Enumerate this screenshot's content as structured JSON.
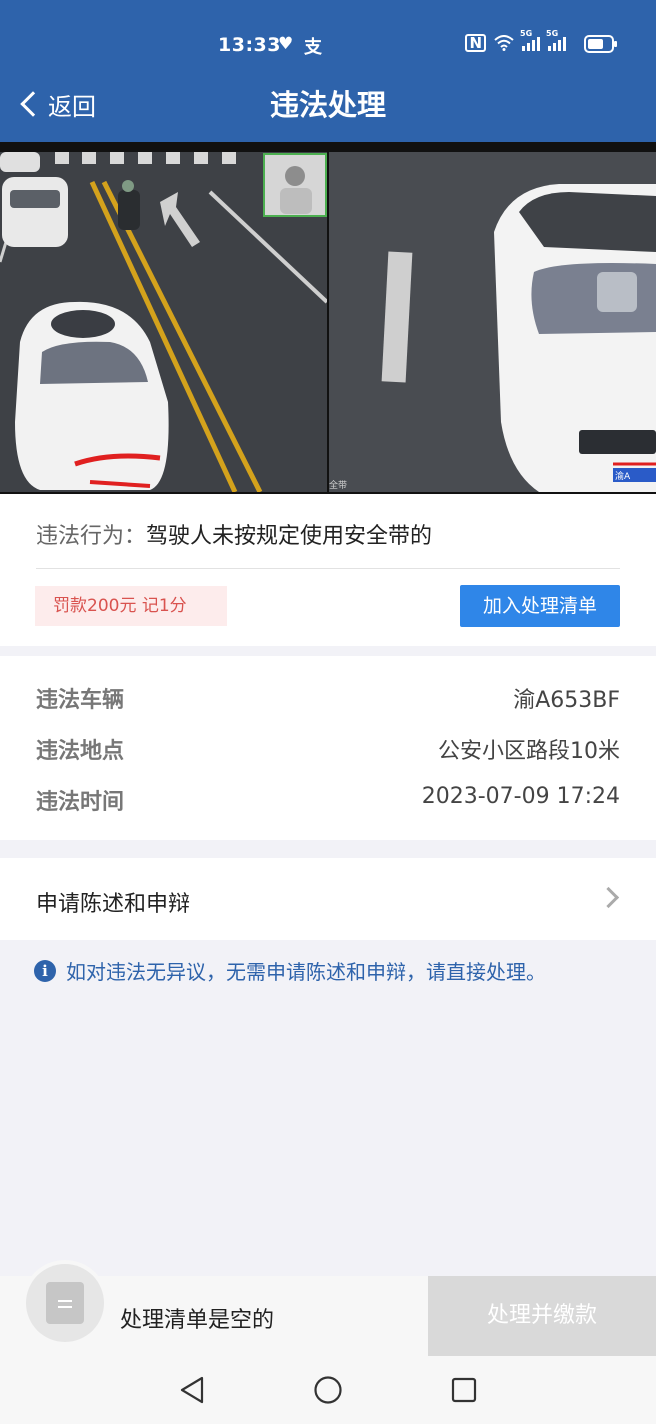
{
  "status_bar": {
    "time": "13:33",
    "heart_icon": "heart-icon",
    "alipay_glyph": "支",
    "network_label_1": "5G",
    "network_label_2": "5G",
    "battery_level": 0.7
  },
  "nav": {
    "back_label": "返回",
    "title": "违法处理"
  },
  "photos": {
    "left_caption": "全带",
    "right_plate_text": "渝A"
  },
  "violation": {
    "label": "违法行为：",
    "value": "驾驶人未按规定使用安全带的",
    "penalty": "罚款200元 记1分",
    "add_button": "加入处理清单"
  },
  "details": [
    {
      "key": "违法车辆",
      "value": "渝A653BF"
    },
    {
      "key": "违法地点",
      "value": "公安小区路段10米"
    },
    {
      "key": "违法时间",
      "value": "2023-07-09 17:24"
    }
  ],
  "appeal": {
    "label": "申请陈述和申辩"
  },
  "notice": {
    "icon": "i",
    "text": "如对违法无异议，无需申请陈述和申辩，请直接处理。"
  },
  "bottom": {
    "empty_text": "处理清单是空的",
    "pay_button": "处理并缴款"
  },
  "colors": {
    "brand": "#2e63ab",
    "button": "#2f86e8",
    "penalty_bg": "#fdecec",
    "penalty_text": "#d9534f"
  }
}
